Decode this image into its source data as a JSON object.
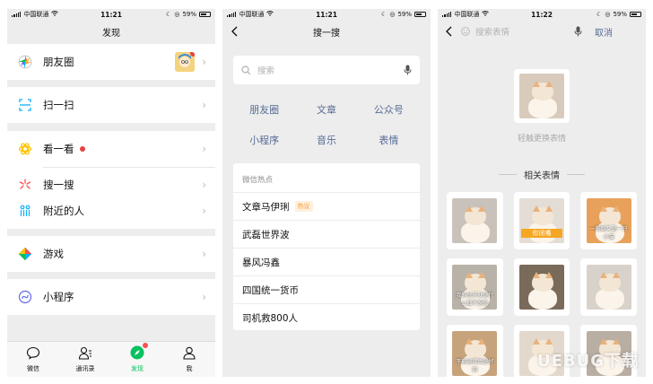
{
  "status": {
    "carrier": "中国联通",
    "battery": "59%",
    "panels": [
      {
        "time": "11:21"
      },
      {
        "time": "11:21"
      },
      {
        "time": "11:22"
      }
    ]
  },
  "panel1": {
    "title": "发现",
    "items": [
      {
        "label": "朋友圈",
        "icon": "moments-icon"
      },
      {
        "label": "扫一扫",
        "icon": "scan-icon"
      },
      {
        "label": "看一看",
        "icon": "top-stories-icon"
      },
      {
        "label": "搜一搜",
        "icon": "search-sparkle-icon"
      },
      {
        "label": "附近的人",
        "icon": "people-nearby-icon"
      },
      {
        "label": "游戏",
        "icon": "games-icon"
      },
      {
        "label": "小程序",
        "icon": "mini-programs-icon"
      }
    ],
    "tabs": [
      {
        "label": "微信"
      },
      {
        "label": "通讯录"
      },
      {
        "label": "发现"
      },
      {
        "label": "我"
      }
    ],
    "accent": "#07c160"
  },
  "panel2": {
    "title": "搜一搜",
    "search_placeholder": "搜索",
    "categories": [
      "朋友圈",
      "文章",
      "公众号",
      "小程序",
      "音乐",
      "表情"
    ],
    "hot_title": "微信热点",
    "hot_items": [
      {
        "label": "文章马伊琍",
        "tag": "热议"
      },
      {
        "label": "武磊世界波",
        "tag": ""
      },
      {
        "label": "暴风冯鑫",
        "tag": ""
      },
      {
        "label": "四国统一货币",
        "tag": ""
      },
      {
        "label": "司机救800人",
        "tag": ""
      }
    ],
    "link_color": "#576b95"
  },
  "panel3": {
    "search_placeholder": "搜索表情",
    "cancel": "取消",
    "hint": "轻触更换表情",
    "related_title": "相关表情",
    "stickers": [
      {
        "caption": ""
      },
      {
        "caption": "你闭嘴"
      },
      {
        "caption": "一脚踢又是一只小猫"
      },
      {
        "caption": "我的快乐就是什么都不想做"
      },
      {
        "caption": ""
      },
      {
        "caption": ""
      },
      {
        "caption": "不能被窝真是好的"
      },
      {
        "caption": ""
      },
      {
        "caption": ""
      }
    ],
    "watermark": "UEBUG下载"
  }
}
